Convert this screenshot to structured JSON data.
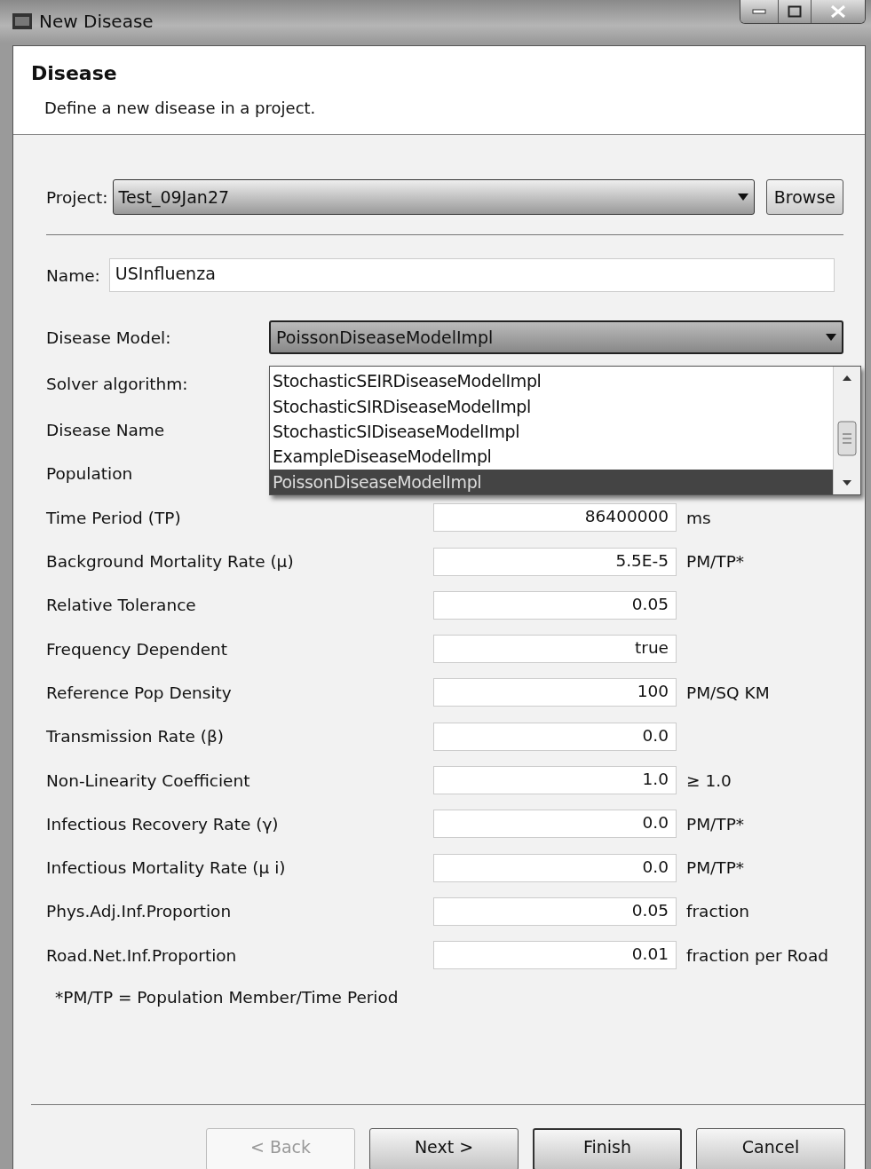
{
  "window": {
    "title": "New Disease"
  },
  "header": {
    "title": "Disease",
    "description": "Define a new disease in a project."
  },
  "project": {
    "label": "Project:",
    "value": "Test_09Jan27",
    "browse": "Browse"
  },
  "name": {
    "label": "Name:",
    "value": "USInfluenza"
  },
  "disease_model": {
    "label": "Disease Model:",
    "value": "PoissonDiseaseModelImpl",
    "expanded": true,
    "options": [
      {
        "label": "StochasticSEIRDiseaseModelImpl",
        "selected": false
      },
      {
        "label": "StochasticSIRDiseaseModelImpl",
        "selected": false
      },
      {
        "label": "StochasticSIDiseaseModelImpl",
        "selected": false
      },
      {
        "label": "ExampleDiseaseModelImpl",
        "selected": false
      },
      {
        "label": "PoissonDiseaseModelImpl",
        "selected": true
      }
    ]
  },
  "solver": {
    "label": "Solver algorithm:"
  },
  "parameters": [
    {
      "label": "Disease Name"
    },
    {
      "label": "Population"
    },
    {
      "label": "Time Period (TP)",
      "value": "86400000",
      "unit": "ms"
    },
    {
      "label": "Background Mortality Rate (μ)",
      "value": "5.5E-5",
      "unit": "PM/TP*"
    },
    {
      "label": "Relative Tolerance",
      "value": "0.05"
    },
    {
      "label": "Frequency Dependent",
      "value": "true"
    },
    {
      "label": "Reference Pop Density",
      "value": "100",
      "unit": "PM/SQ KM"
    },
    {
      "label": "Transmission Rate (β)",
      "value": "0.0"
    },
    {
      "label": "Non-Linearity Coefficient",
      "value": "1.0",
      "unit": "≥ 1.0"
    },
    {
      "label": "Infectious Recovery Rate (γ)",
      "value": "0.0",
      "unit": "PM/TP*"
    },
    {
      "label": "Infectious Mortality Rate (μ i)",
      "value": "0.0",
      "unit": "PM/TP*"
    },
    {
      "label": "Phys.Adj.Inf.Proportion",
      "value": "0.05",
      "unit": "fraction"
    },
    {
      "label": "Road.Net.Inf.Proportion",
      "value": "0.01",
      "unit": "fraction per Road"
    }
  ],
  "footnote": "*PM/TP = Population Member/Time Period",
  "buttons": [
    {
      "label": "< Back",
      "disabled": true,
      "default": false
    },
    {
      "label": "Next >",
      "disabled": false,
      "default": false
    },
    {
      "label": "Finish",
      "disabled": false,
      "default": true
    },
    {
      "label": "Cancel",
      "disabled": false,
      "default": false
    }
  ]
}
